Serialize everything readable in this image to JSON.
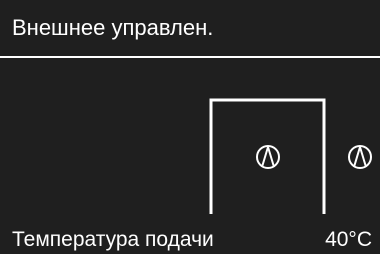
{
  "header": {
    "title": "Внешнее управлен."
  },
  "schematic": {
    "left_pump_icon": "pump-icon",
    "right_pump_icon": "pump-icon"
  },
  "footer": {
    "label": "Температура подачи",
    "value": "40°C"
  },
  "colors": {
    "background": "#1f1f1f",
    "foreground": "#ffffff"
  }
}
